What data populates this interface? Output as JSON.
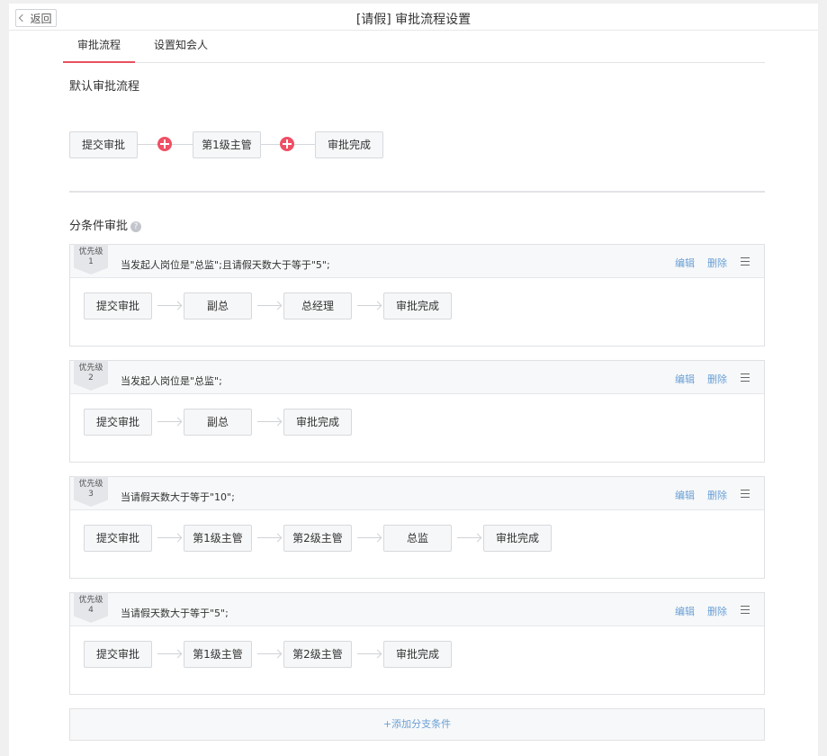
{
  "header": {
    "back_label": "返回",
    "title": "[请假] 审批流程设置"
  },
  "tabs": [
    {
      "label": "审批流程",
      "active": true
    },
    {
      "label": "设置知会人",
      "active": false
    }
  ],
  "default_flow": {
    "title": "默认审批流程",
    "nodes": [
      "提交审批",
      "第1级主管",
      "审批完成"
    ]
  },
  "conditional": {
    "title": "分条件审批",
    "help_glyph": "?",
    "edit_label": "编辑",
    "delete_label": "删除",
    "branches": [
      {
        "priority_label": "优先级",
        "priority": "1",
        "condition": "当发起人岗位是\"总监\";且请假天数大于等于\"5\";",
        "nodes": [
          "提交审批",
          "副总",
          "总经理",
          "审批完成"
        ]
      },
      {
        "priority_label": "优先级",
        "priority": "2",
        "condition": "当发起人岗位是\"总监\";",
        "nodes": [
          "提交审批",
          "副总",
          "审批完成"
        ]
      },
      {
        "priority_label": "优先级",
        "priority": "3",
        "condition": "当请假天数大于等于\"10\";",
        "nodes": [
          "提交审批",
          "第1级主管",
          "第2级主管",
          "总监",
          "审批完成"
        ]
      },
      {
        "priority_label": "优先级",
        "priority": "4",
        "condition": "当请假天数大于等于\"5\";",
        "nodes": [
          "提交审批",
          "第1级主管",
          "第2级主管",
          "审批完成"
        ]
      }
    ],
    "add_branch_label": "+添加分支条件"
  },
  "colors": {
    "accent": "#ef4f65",
    "link": "#6aa0d6",
    "tab_underline": "#e8505f"
  },
  "icons": {
    "back": "chevron-left-icon",
    "add": "plus-circle-icon",
    "menu": "menu-icon",
    "help": "question-icon",
    "arrow": "arrow-right-icon"
  }
}
